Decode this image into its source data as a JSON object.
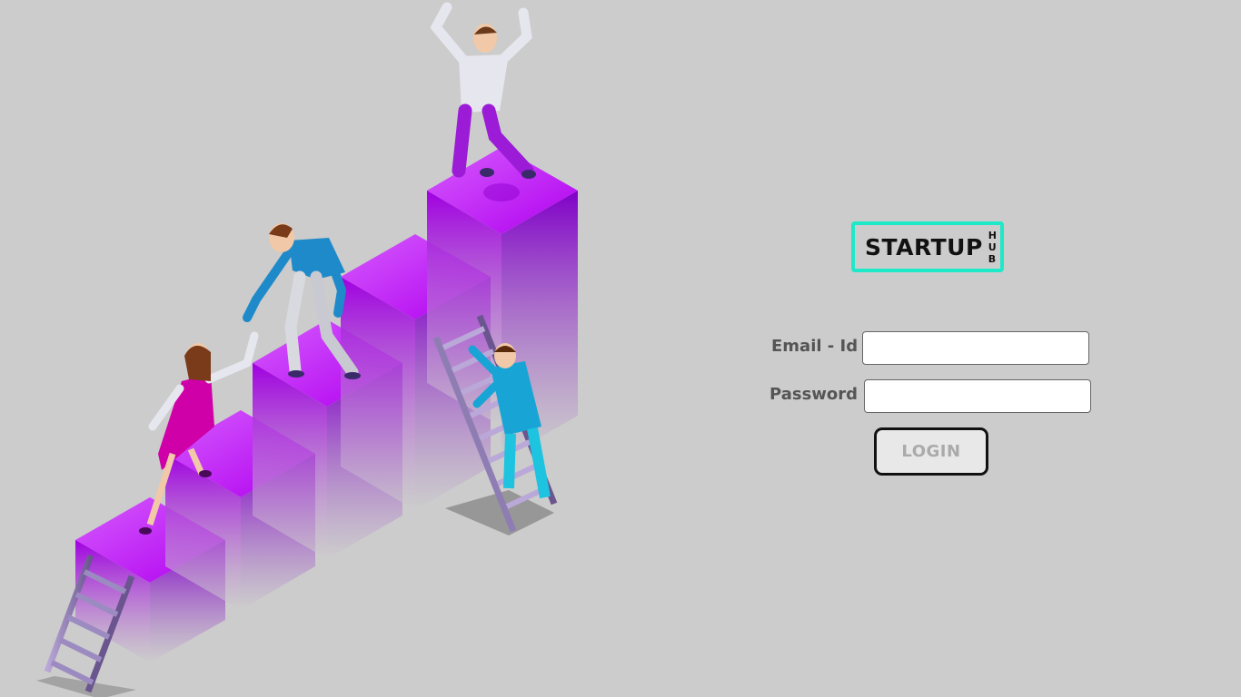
{
  "logo": {
    "main": "STARTUP",
    "side_letters": [
      "H",
      "U",
      "B"
    ],
    "border_color": "#1de9c8"
  },
  "form": {
    "email_label": "Email - Id",
    "email_value": "",
    "password_label": "Password",
    "password_value": "",
    "login_label": "LOGIN"
  },
  "hero": {
    "accent_color": "#a000e0",
    "icon": "people-climbing-steps-illustration"
  }
}
